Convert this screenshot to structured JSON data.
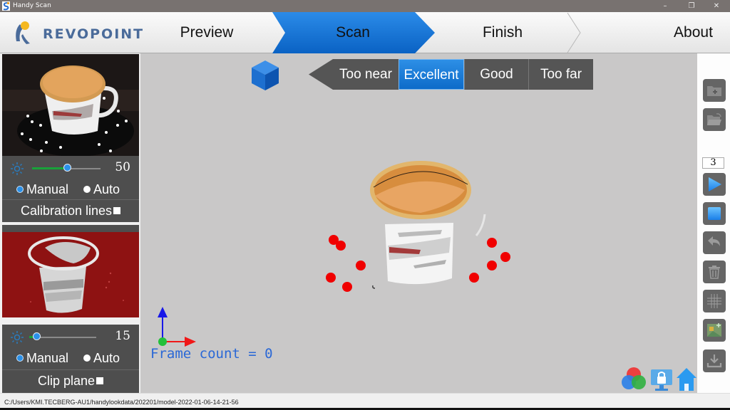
{
  "window": {
    "title": "Handy Scan",
    "controls": {
      "minimize": "–",
      "restore": "❐",
      "close": "✕"
    }
  },
  "nav": {
    "brand": "REVOPOINT",
    "tabs": [
      {
        "label": "Preview",
        "active": false
      },
      {
        "label": "Scan",
        "active": true
      },
      {
        "label": "Finish",
        "active": false
      },
      {
        "label": "About",
        "active": false
      }
    ],
    "accent": "#1a74d6"
  },
  "left_panel": {
    "color_camera": {
      "icon": "sun-icon",
      "exposure_label": "50",
      "exposure_fraction": 0.52,
      "mode_options": [
        "Manual",
        "Auto"
      ],
      "mode_selected": "Manual",
      "checkbox_label": "Calibration lines"
    },
    "depth_camera": {
      "icon": "sun-icon",
      "exposure_label": "15",
      "exposure_fraction": 0.12,
      "mode_options": [
        "Manual",
        "Auto"
      ],
      "mode_selected": "Manual",
      "checkbox_label": "Clip plane"
    }
  },
  "viewport": {
    "distance_indicator": {
      "levels": [
        "Too near",
        "Excellent",
        "Good",
        "Too far"
      ],
      "active": "Excellent"
    },
    "frame_count_text": "Frame count = 0",
    "axis_colors": {
      "x": "#f01818",
      "y": "#1818e8",
      "origin": "#22c03a"
    }
  },
  "right_toolbar": {
    "buttons": [
      {
        "name": "new-project-button",
        "icon": "folder-plus-icon"
      },
      {
        "name": "open-project-button",
        "icon": "folder-open-icon"
      },
      {
        "name": "start-scan-button",
        "icon": "play-icon"
      },
      {
        "name": "stop-scan-button",
        "icon": "stop-icon"
      },
      {
        "name": "undo-button",
        "icon": "undo-icon"
      },
      {
        "name": "delete-button",
        "icon": "trash-icon"
      },
      {
        "name": "grid-button",
        "icon": "grid-icon"
      },
      {
        "name": "texture-button",
        "icon": "image-icon"
      },
      {
        "name": "export-button",
        "icon": "download-icon"
      }
    ],
    "frame_step_value": "3"
  },
  "status_bar": {
    "path": "C:/Users/KMI.TECBERG-AU1/handylookdata/202201/model-2022-01-06-14-21-56"
  }
}
